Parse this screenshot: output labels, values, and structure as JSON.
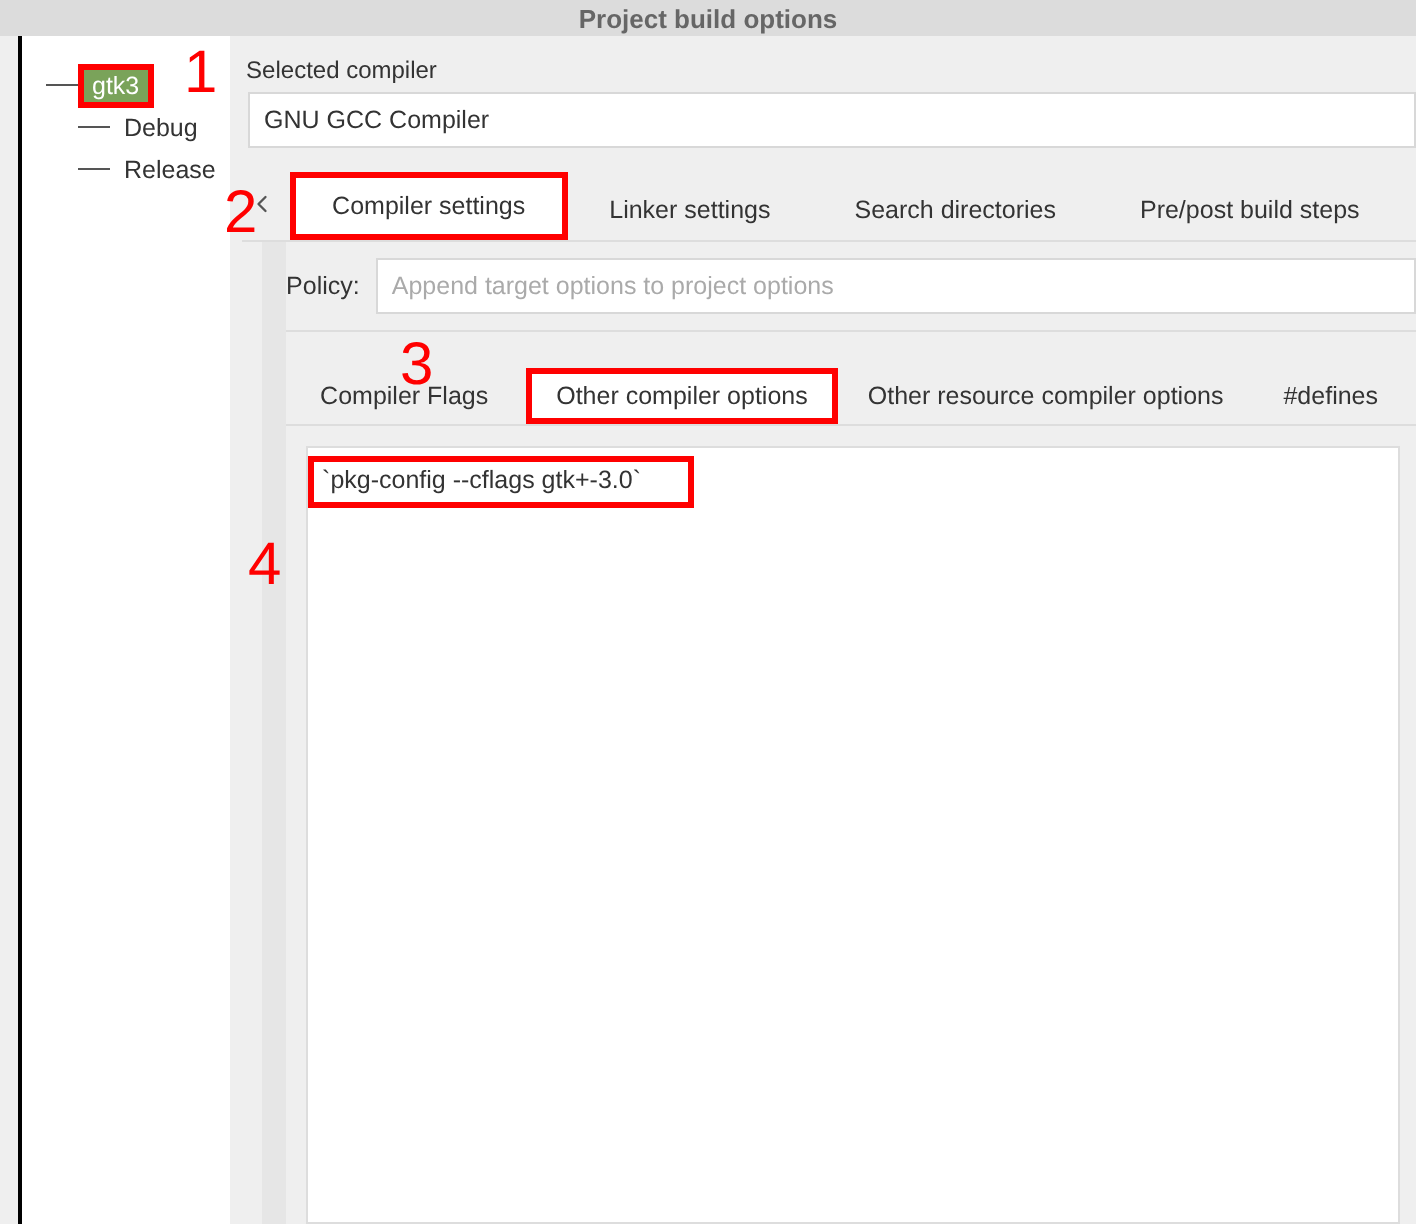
{
  "window": {
    "title": "Project build options"
  },
  "tree": [
    {
      "label": "gtk3",
      "selected": true,
      "annotated": true,
      "children": [
        {
          "label": "Debug",
          "selected": false,
          "annotated": false
        },
        {
          "label": "Release",
          "selected": false,
          "annotated": false
        }
      ]
    }
  ],
  "selected_compiler": {
    "label": "Selected compiler",
    "value": "GNU GCC Compiler"
  },
  "tabs": [
    {
      "label": "Compiler settings",
      "selected": true,
      "annotated": true
    },
    {
      "label": "Linker settings",
      "selected": false,
      "annotated": false
    },
    {
      "label": "Search directories",
      "selected": false,
      "annotated": false
    },
    {
      "label": "Pre/post build steps",
      "selected": false,
      "annotated": false
    }
  ],
  "policy": {
    "label": "Policy:",
    "placeholder": "Append target options to project options",
    "disabled": true
  },
  "subtabs": [
    {
      "label": "Compiler Flags",
      "selected": false,
      "annotated": false
    },
    {
      "label": "Other compiler options",
      "selected": true,
      "annotated": true
    },
    {
      "label": "Other resource compiler options",
      "selected": false,
      "annotated": false
    },
    {
      "label": "#defines",
      "selected": false,
      "annotated": false
    }
  ],
  "editor": {
    "lines": [
      {
        "text": "`pkg-config --cflags gtk+-3.0`",
        "annotated": true
      }
    ]
  },
  "annotations": [
    "1",
    "2",
    "3",
    "4"
  ]
}
